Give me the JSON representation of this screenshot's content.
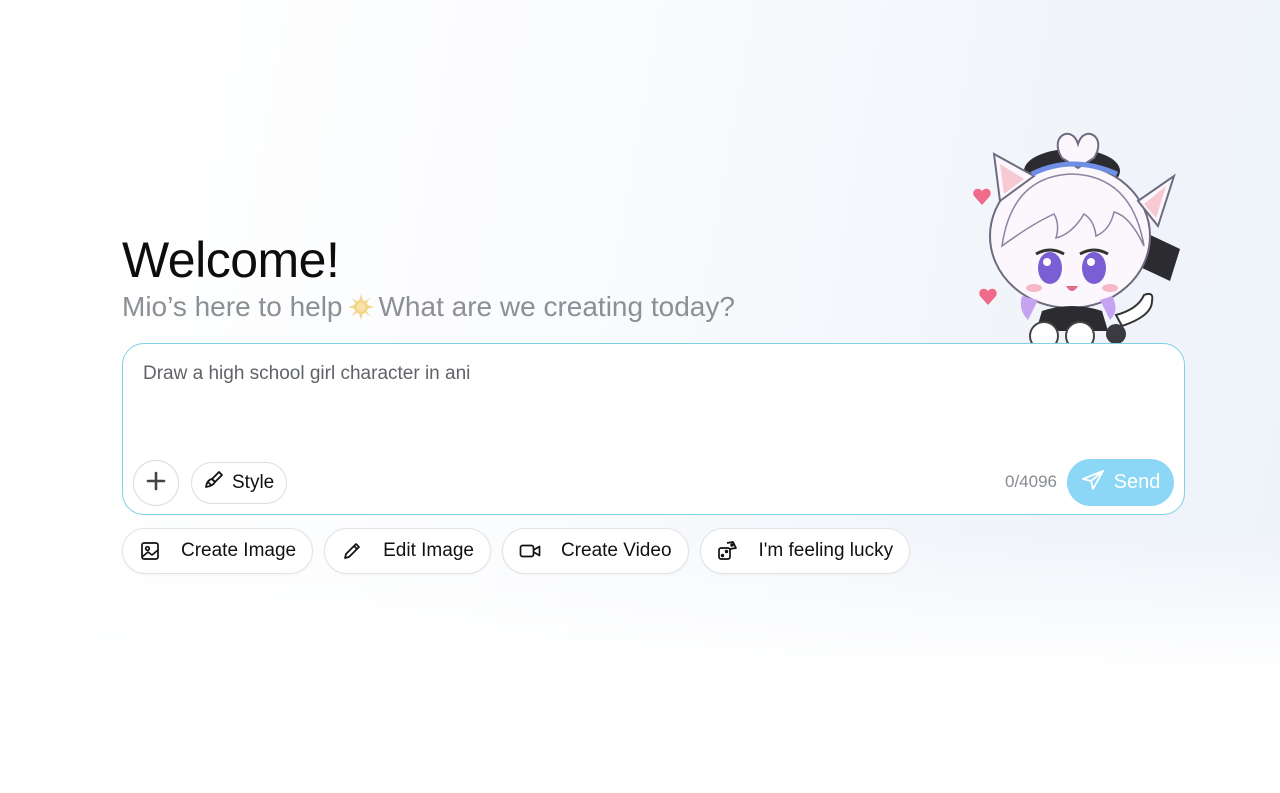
{
  "hero": {
    "title": "Welcome!",
    "subtitle_before": "Mio’s here to help",
    "subtitle_after": "What are we creating today?"
  },
  "prompt": {
    "value": "Draw a high school girl character in ani",
    "char_count": "0/4096"
  },
  "toolbar": {
    "style_label": "Style",
    "send_label": "Send"
  },
  "actions": [
    {
      "label": "Create Image",
      "icon": "image-icon"
    },
    {
      "label": "Edit Image",
      "icon": "pencil-icon"
    },
    {
      "label": "Create Video",
      "icon": "video-icon"
    },
    {
      "label": "I'm feeling lucky",
      "icon": "dice-icon"
    }
  ],
  "colors": {
    "accent_border": "#7fd0e3",
    "send_bg": "#8cd7f5",
    "subtitle": "#8c8f95"
  }
}
